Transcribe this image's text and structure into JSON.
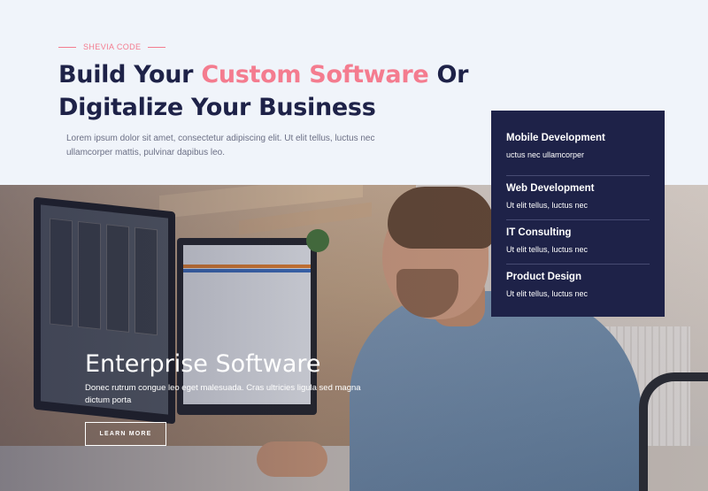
{
  "header": {
    "eyebrow": "SHEVIA CODE",
    "headline_part1": "Build Your ",
    "headline_accent": "Custom Software",
    "headline_part2": " Or",
    "headline_line2": "Digitalize Your Business",
    "intro": "Lorem ipsum dolor sit amet, consectetur adipiscing elit. Ut elit tellus, luctus nec ullamcorper mattis, pulvinar dapibus leo."
  },
  "services": [
    {
      "title": "Mobile Development",
      "desc": "uctus nec ullamcorper"
    },
    {
      "title": "Web Development",
      "desc": "Ut elit tellus, luctus nec"
    },
    {
      "title": "IT Consulting",
      "desc": "Ut elit tellus, luctus nec"
    },
    {
      "title": "Product Design",
      "desc": "Ut elit tellus, luctus nec"
    }
  ],
  "hero": {
    "title": "Enterprise Software",
    "text": "Donec rutrum congue leo eget malesuada. Cras ultricies ligula sed magna dictum porta",
    "button_label": "LEARN MORE"
  },
  "colors": {
    "accent": "#f47c8f",
    "navy": "#1e2248",
    "background": "#f0f4fa"
  }
}
